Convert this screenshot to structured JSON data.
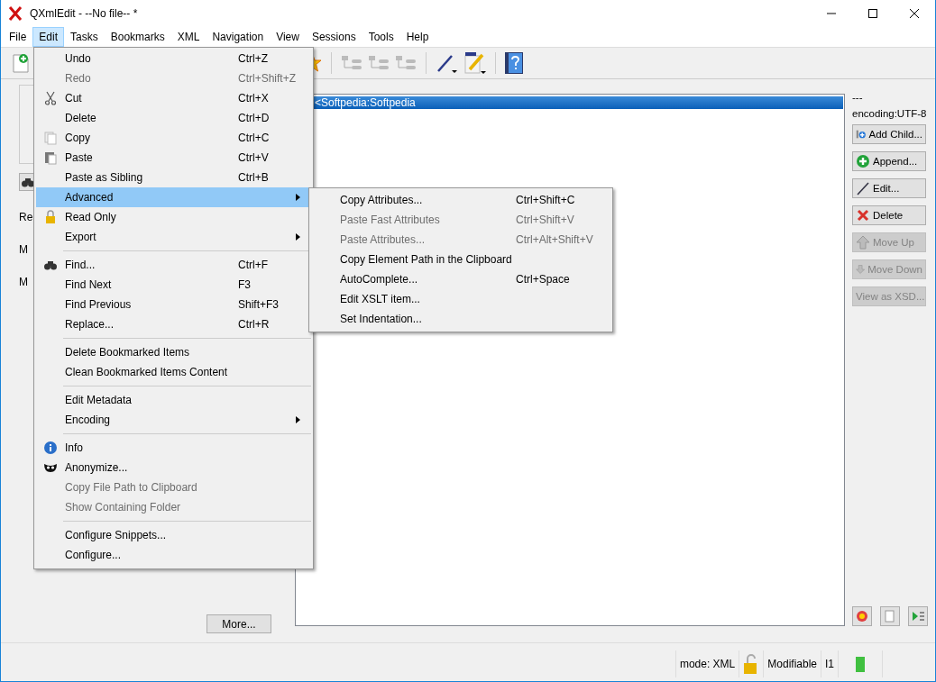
{
  "window": {
    "title": "QXmlEdit - --No file-- *"
  },
  "menu_bar": [
    {
      "label": "File",
      "selected": false
    },
    {
      "label": "Edit",
      "selected": true
    },
    {
      "label": "Tasks",
      "selected": false
    },
    {
      "label": "Bookmarks",
      "selected": false
    },
    {
      "label": "XML",
      "selected": false
    },
    {
      "label": "Navigation",
      "selected": false
    },
    {
      "label": "View",
      "selected": false
    },
    {
      "label": "Sessions",
      "selected": false
    },
    {
      "label": "Tools",
      "selected": false
    },
    {
      "label": "Help",
      "selected": false
    }
  ],
  "left_panel": {
    "labels": [
      "Re",
      "M",
      "M"
    ],
    "more_button": "More..."
  },
  "tree": {
    "rows": [
      {
        "label": "<Softpedia:Softpedia",
        "selected": true
      }
    ]
  },
  "right_panel": {
    "header": "---",
    "encoding": "encoding:UTF-8",
    "buttons": [
      {
        "label": "Add Child...",
        "disabled": false
      },
      {
        "label": "Append...",
        "disabled": false
      },
      {
        "label": "Edit...",
        "disabled": false
      },
      {
        "label": "Delete",
        "disabled": false
      },
      {
        "label": "Move Up",
        "disabled": true
      },
      {
        "label": "Move Down",
        "disabled": true
      },
      {
        "label": "View as XSD...",
        "disabled": true
      }
    ]
  },
  "status_bar": {
    "mode": "mode: XML",
    "state": "Modifiable",
    "indicator": "I1"
  },
  "edit_menu": {
    "items": [
      {
        "kind": "item",
        "label": "Undo",
        "shortcut": "Ctrl+Z",
        "disabled": false,
        "selected": false,
        "submenu": false
      },
      {
        "kind": "item",
        "label": "Redo",
        "shortcut": "Ctrl+Shift+Z",
        "disabled": true,
        "selected": false,
        "submenu": false
      },
      {
        "kind": "item",
        "label": "Cut",
        "shortcut": "Ctrl+X",
        "disabled": false,
        "selected": false,
        "submenu": false
      },
      {
        "kind": "item",
        "label": "Delete",
        "shortcut": "Ctrl+D",
        "disabled": false,
        "selected": false,
        "submenu": false
      },
      {
        "kind": "item",
        "label": "Copy",
        "shortcut": "Ctrl+C",
        "disabled": false,
        "selected": false,
        "submenu": false
      },
      {
        "kind": "item",
        "label": "Paste",
        "shortcut": "Ctrl+V",
        "disabled": false,
        "selected": false,
        "submenu": false
      },
      {
        "kind": "item",
        "label": "Paste as Sibling",
        "shortcut": "Ctrl+B",
        "disabled": false,
        "selected": false,
        "submenu": false
      },
      {
        "kind": "item",
        "label": "Advanced",
        "disabled": false,
        "selected": true,
        "submenu": true
      },
      {
        "kind": "item",
        "label": "Read Only",
        "disabled": false,
        "selected": false,
        "submenu": false
      },
      {
        "kind": "item",
        "label": "Export",
        "disabled": false,
        "selected": false,
        "submenu": true
      },
      {
        "kind": "separator"
      },
      {
        "kind": "item",
        "label": "Find...",
        "shortcut": "Ctrl+F",
        "disabled": false,
        "selected": false,
        "submenu": false
      },
      {
        "kind": "item",
        "label": "Find Next",
        "shortcut": "F3",
        "disabled": false,
        "selected": false,
        "submenu": false
      },
      {
        "kind": "item",
        "label": "Find Previous",
        "shortcut": "Shift+F3",
        "disabled": false,
        "selected": false,
        "submenu": false
      },
      {
        "kind": "item",
        "label": "Replace...",
        "shortcut": "Ctrl+R",
        "disabled": false,
        "selected": false,
        "submenu": false
      },
      {
        "kind": "separator"
      },
      {
        "kind": "item",
        "label": "Delete Bookmarked Items",
        "disabled": false,
        "selected": false,
        "submenu": false
      },
      {
        "kind": "item",
        "label": "Clean Bookmarked Items Content",
        "disabled": false,
        "selected": false,
        "submenu": false
      },
      {
        "kind": "separator"
      },
      {
        "kind": "item",
        "label": "Edit Metadata",
        "disabled": false,
        "selected": false,
        "submenu": false
      },
      {
        "kind": "item",
        "label": "Encoding",
        "disabled": false,
        "selected": false,
        "submenu": true
      },
      {
        "kind": "separator"
      },
      {
        "kind": "item",
        "label": "Info",
        "disabled": false,
        "selected": false,
        "submenu": false
      },
      {
        "kind": "item",
        "label": "Anonymize...",
        "disabled": false,
        "selected": false,
        "submenu": false
      },
      {
        "kind": "item",
        "label": "Copy File Path to Clipboard",
        "disabled": true,
        "selected": false,
        "submenu": false
      },
      {
        "kind": "item",
        "label": "Show Containing Folder",
        "disabled": true,
        "selected": false,
        "submenu": false
      },
      {
        "kind": "separator"
      },
      {
        "kind": "item",
        "label": "Configure Snippets...",
        "disabled": false,
        "selected": false,
        "submenu": false
      },
      {
        "kind": "item",
        "label": "Configure...",
        "disabled": false,
        "selected": false,
        "submenu": false
      }
    ]
  },
  "advanced_submenu": {
    "items": [
      {
        "label": "Copy Attributes...",
        "shortcut": "Ctrl+Shift+C",
        "disabled": false
      },
      {
        "label": "Paste Fast Attributes",
        "shortcut": "Ctrl+Shift+V",
        "disabled": true
      },
      {
        "label": "Paste Attributes...",
        "shortcut": "Ctrl+Alt+Shift+V",
        "disabled": true
      },
      {
        "label": "Copy Element Path in the Clipboard",
        "disabled": false
      },
      {
        "label": "AutoComplete...",
        "shortcut": "Ctrl+Space",
        "disabled": false
      },
      {
        "label": "Edit XSLT item...",
        "disabled": false
      },
      {
        "label": "Set Indentation...",
        "disabled": false
      }
    ]
  }
}
